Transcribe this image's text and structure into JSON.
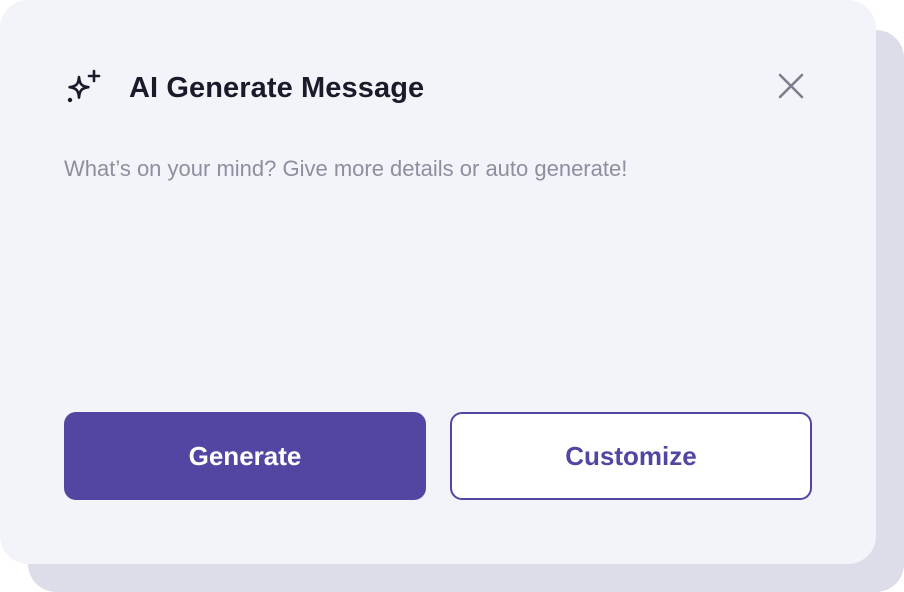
{
  "dialog": {
    "title": "AI Generate Message",
    "title_icon": "sparkle-icon",
    "close_icon": "close-icon",
    "prompt": {
      "value": "",
      "placeholder": "What’s on your mind? Give more details or auto generate!"
    },
    "buttons": {
      "generate_label": "Generate",
      "customize_label": "Customize"
    }
  },
  "colors": {
    "accent": "#5147a3",
    "dialog_background": "#f3f4f9",
    "backdrop_shadow": "#dcdde8",
    "title_text": "#1a1b2a",
    "placeholder_text": "#8c8f9e",
    "close_icon": "#7b7e8c"
  }
}
